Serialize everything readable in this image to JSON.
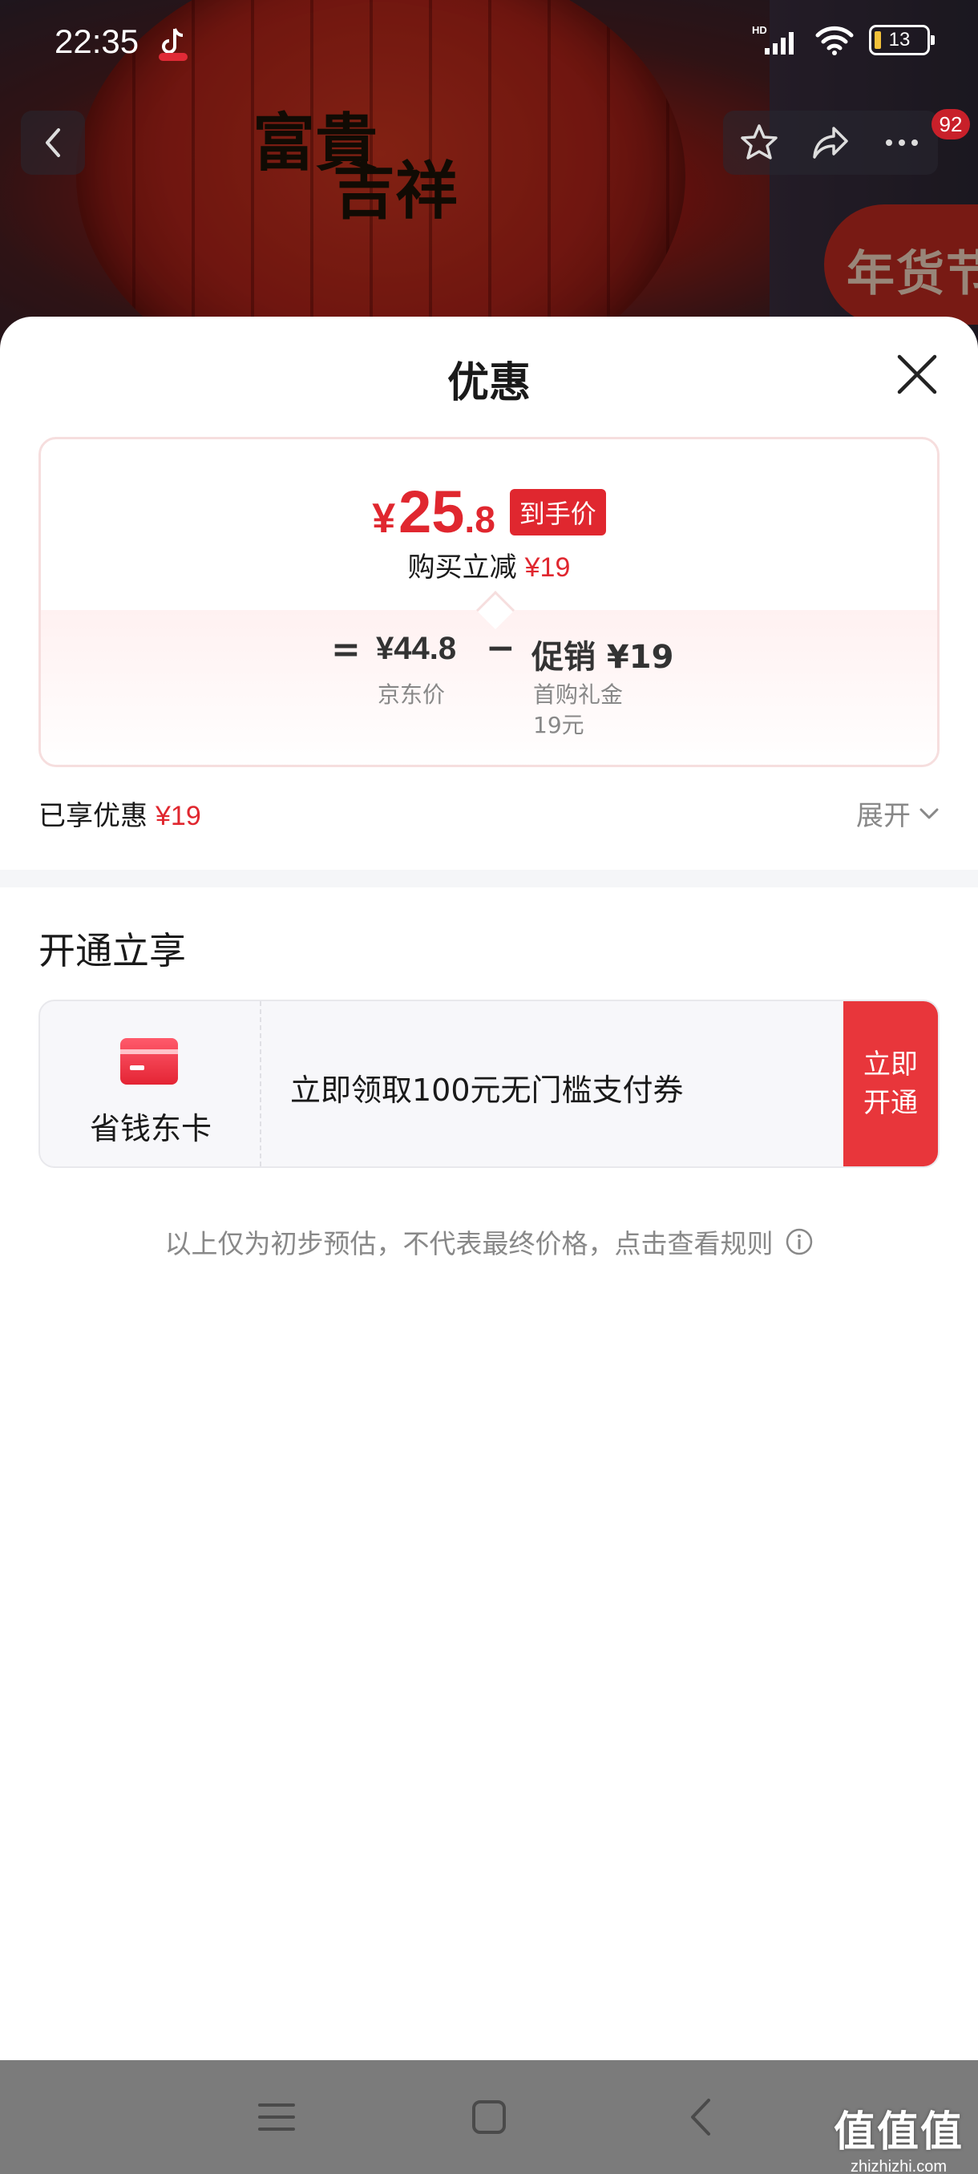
{
  "status_bar": {
    "time": "22:35",
    "battery": "13",
    "network": "HD"
  },
  "nav": {
    "badge_count": "92"
  },
  "hero": {
    "lantern_text_1": "富貴",
    "lantern_text_2": "吉祥",
    "festival_badge": "年货节"
  },
  "sheet": {
    "title": "优惠",
    "final_price": {
      "currency": "¥",
      "integer": "25",
      "decimal": ".8",
      "tag": "到手价"
    },
    "reduce": {
      "label": "购买立减",
      "amount": "¥19"
    },
    "formula": {
      "equals": "=",
      "base_price": "¥44.8",
      "base_label": "京东价",
      "minus": "−",
      "promo": "促销 ¥19",
      "promo_sub_1": "首购礼金",
      "promo_sub_2": "19元"
    },
    "enjoyed": {
      "label": "已享优惠",
      "amount": "¥19"
    },
    "expand_label": "展开",
    "section_title": "开通立享",
    "offer": {
      "brand_name": "省钱东卡",
      "description": "立即领取100元无门槛支付券",
      "cta": "立即开通"
    },
    "disclaimer": "以上仅为初步预估，不代表最终价格，点击查看规则"
  },
  "watermark": {
    "big": "值值值",
    "small": "zhizhizhi.com"
  },
  "colors": {
    "accent_red": "#e0272f",
    "cta_red": "#e8363b",
    "muted": "#888888"
  }
}
